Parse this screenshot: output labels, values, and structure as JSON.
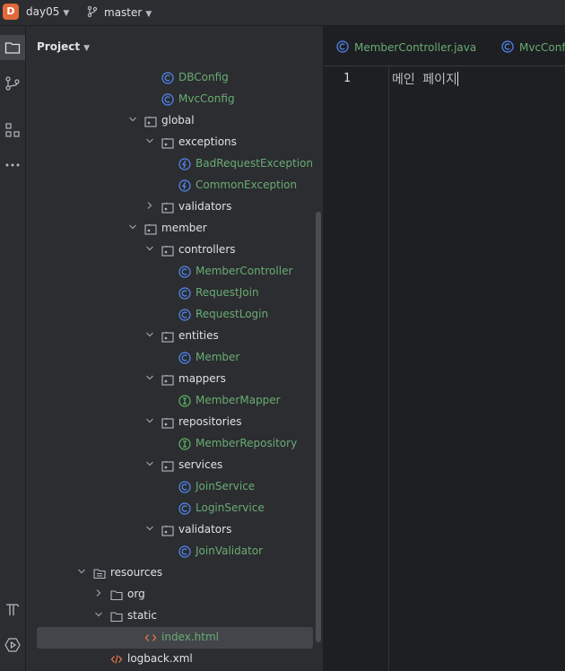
{
  "titlebar": {
    "project_badge": "D",
    "project_name": "day05",
    "branch": "master"
  },
  "project_panel": {
    "title": "Project",
    "tree": [
      {
        "label": "DBConfig",
        "kind": "class",
        "depth": 5
      },
      {
        "label": "MvcConfig",
        "kind": "class",
        "depth": 5
      },
      {
        "label": "global",
        "kind": "package",
        "depth": 4,
        "expanded": true
      },
      {
        "label": "exceptions",
        "kind": "package",
        "depth": 5,
        "expanded": true
      },
      {
        "label": "BadRequestException",
        "kind": "exception",
        "depth": 6
      },
      {
        "label": "CommonException",
        "kind": "exception",
        "depth": 6
      },
      {
        "label": "validators",
        "kind": "package",
        "depth": 5,
        "expanded": false
      },
      {
        "label": "member",
        "kind": "package",
        "depth": 4,
        "expanded": true
      },
      {
        "label": "controllers",
        "kind": "package",
        "depth": 5,
        "expanded": true
      },
      {
        "label": "MemberController",
        "kind": "class",
        "depth": 6
      },
      {
        "label": "RequestJoin",
        "kind": "class",
        "depth": 6
      },
      {
        "label": "RequestLogin",
        "kind": "class",
        "depth": 6
      },
      {
        "label": "entities",
        "kind": "package",
        "depth": 5,
        "expanded": true
      },
      {
        "label": "Member",
        "kind": "class",
        "depth": 6
      },
      {
        "label": "mappers",
        "kind": "package",
        "depth": 5,
        "expanded": true
      },
      {
        "label": "MemberMapper",
        "kind": "interface",
        "depth": 6
      },
      {
        "label": "repositories",
        "kind": "package",
        "depth": 5,
        "expanded": true
      },
      {
        "label": "MemberRepository",
        "kind": "interface",
        "depth": 6
      },
      {
        "label": "services",
        "kind": "package",
        "depth": 5,
        "expanded": true
      },
      {
        "label": "JoinService",
        "kind": "class",
        "depth": 6
      },
      {
        "label": "LoginService",
        "kind": "class",
        "depth": 6
      },
      {
        "label": "validators",
        "kind": "package",
        "depth": 5,
        "expanded": true
      },
      {
        "label": "JoinValidator",
        "kind": "class",
        "depth": 6
      },
      {
        "label": "resources",
        "kind": "resources",
        "depth": 2,
        "expanded": true
      },
      {
        "label": "org",
        "kind": "folder",
        "depth": 3,
        "expanded": false
      },
      {
        "label": "static",
        "kind": "folder",
        "depth": 3,
        "expanded": true
      },
      {
        "label": "index.html",
        "kind": "html",
        "depth": 4,
        "selected": true
      },
      {
        "label": "logback.xml",
        "kind": "xml",
        "depth": 3
      }
    ]
  },
  "editor": {
    "tabs": [
      {
        "label": "MemberController.java"
      },
      {
        "label": "MvcConf"
      }
    ],
    "line_number": "1",
    "code_line": "메인 페이지"
  },
  "colors": {
    "accent_blue": "#548af7",
    "class_green": "#6aab73",
    "interface_green": "#5fb865",
    "html_orange": "#e8754a"
  }
}
